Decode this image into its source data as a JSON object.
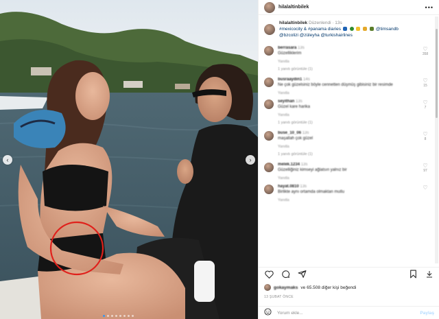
{
  "post": {
    "username": "hilalaltinbilek"
  },
  "caption": {
    "username": "hilalaltinbilek",
    "meta": "Düzenlendi · 13s",
    "hashtags": "#mexicocity & #panama diaries",
    "mentions_line1": "@timsandb",
    "mentions_line2": "@bzcolizi @züleyha @turkishairlines"
  },
  "comments": [
    {
      "user": "berrasara",
      "time": "13s",
      "text": "Güzelliklerim",
      "reply": "Yanıtla",
      "likes": "358",
      "show_replies": "1 yanıtı görüntüle (1)"
    },
    {
      "user": "busraaydin1",
      "time": "14s",
      "text": "Ne çok güzelsiniz böyle cennetten düşmüş gibisiniz bir resimde",
      "reply": "Yanıtla",
      "likes": "15",
      "show_replies": ""
    },
    {
      "user": "seyithan",
      "time": "13s",
      "text": "Güzel kare harika",
      "reply": "Yanıtla",
      "likes": "7",
      "show_replies": "1 yanıtı görüntüle (1)"
    },
    {
      "user": "buse_10_06",
      "time": "13s",
      "text": "maşallah çok güzel",
      "reply": "Yanıtla",
      "likes": "8",
      "show_replies": "1 yanıtı görüntüle (1)"
    },
    {
      "user": "melek.1234",
      "time": "13s",
      "text": "Güzelliğiniz kimseyi ağlatsın yalnız bir",
      "reply": "Yanıtla",
      "likes": "97",
      "show_replies": ""
    },
    {
      "user": "hayat.0810",
      "time": "13s",
      "text": "Birlikte aynı ortamda olmaktan mutlu",
      "reply": "Yanıtla",
      "likes": "",
      "show_replies": ""
    }
  ],
  "likes": {
    "blurred_user": "gokaymaks",
    "text": "ve 65.508 diğer kişi beğendi"
  },
  "timestamp": "13 ŞUBAT ÖNCE",
  "add_comment": {
    "placeholder": "Yorum ekle...",
    "post_label": "Paylaş"
  },
  "icons": {
    "more": "more-icon",
    "like": "heart-icon",
    "comment": "comment-icon",
    "share": "share-icon",
    "save": "bookmark-icon",
    "download": "download-icon",
    "emoji": "emoji-icon",
    "prev": "chevron-left-icon",
    "next": "chevron-right-icon"
  },
  "colors": {
    "link": "#00376b",
    "muted": "#8e8e8e",
    "highlight_circle": "#e0201b",
    "post_button": "#b3dbff"
  }
}
